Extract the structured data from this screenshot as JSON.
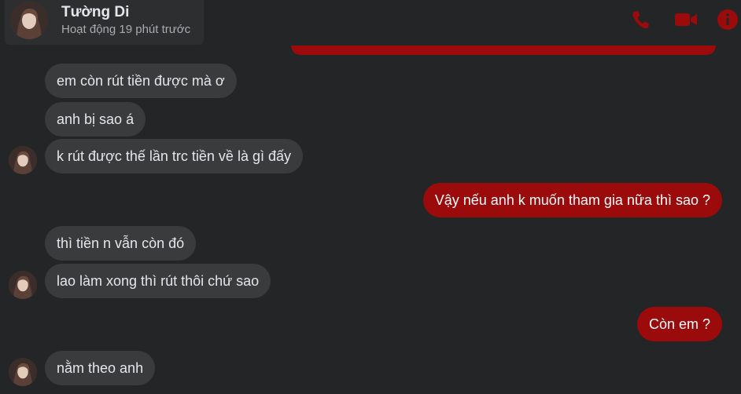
{
  "header": {
    "contact_name": "Tường Di",
    "status": "Hoạt động 19 phút trước",
    "accent_color": "#9b0b0b",
    "icons": [
      "phone-icon",
      "video-camera-icon",
      "info-icon"
    ]
  },
  "messages": [
    {
      "side": "incoming",
      "text": "em còn rút tiền được mà ơ"
    },
    {
      "side": "incoming",
      "text": "anh bị sao á"
    },
    {
      "side": "incoming",
      "text": "k rút được thế lần trc tiền về là gì đấy"
    },
    {
      "side": "outgoing",
      "text": "Vậy nếu anh k muốn tham gia nữa thì sao ?"
    },
    {
      "side": "incoming",
      "text": "thì tiền n vẫn còn đó"
    },
    {
      "side": "incoming",
      "text": "lao làm xong thì rút thôi chứ sao"
    },
    {
      "side": "outgoing",
      "text": "Còn em ?"
    },
    {
      "side": "incoming",
      "text": "nằm theo anh"
    }
  ]
}
